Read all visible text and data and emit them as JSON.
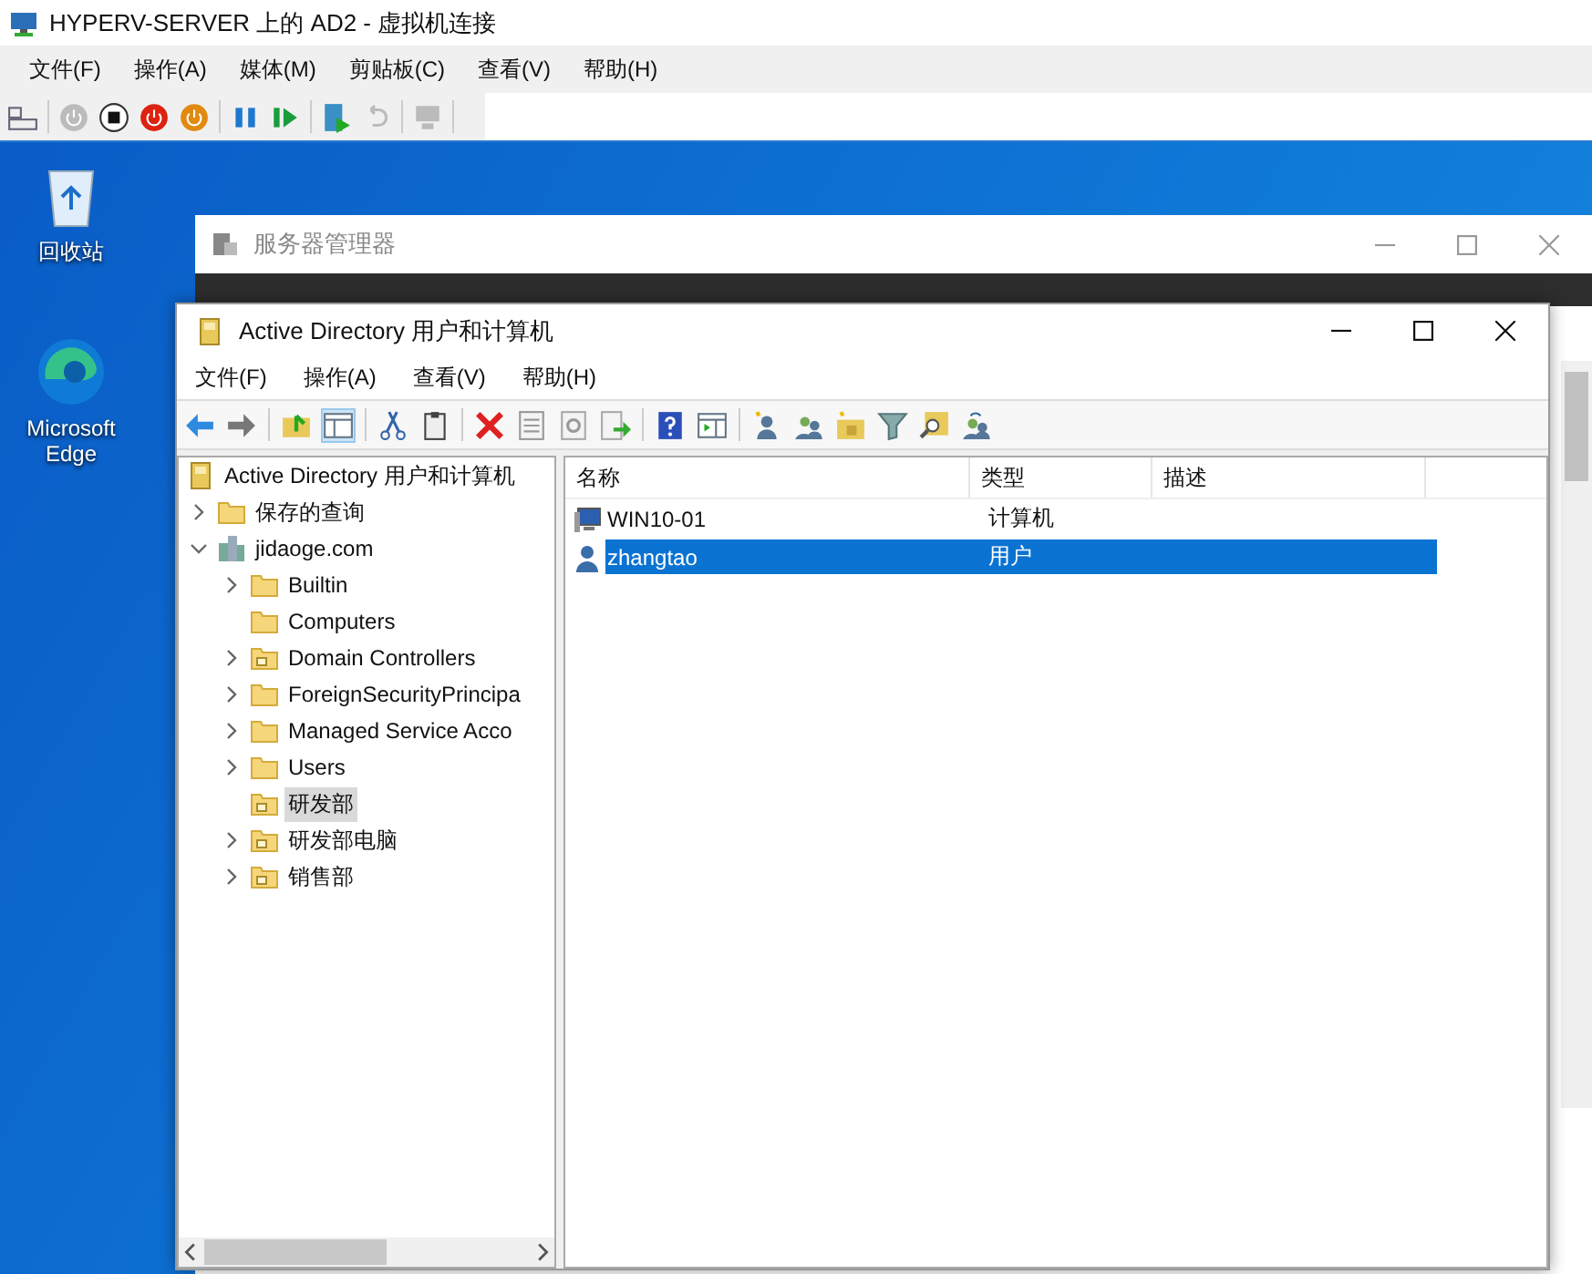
{
  "vm_window": {
    "title": "HYPERV-SERVER 上的 AD2 - 虚拟机连接",
    "menu": [
      "文件(F)",
      "操作(A)",
      "媒体(M)",
      "剪贴板(C)",
      "查看(V)",
      "帮助(H)"
    ]
  },
  "desktop_icons": [
    {
      "label": "回收站",
      "kind": "recycle"
    },
    {
      "label": "Microsoft Edge",
      "kind": "edge"
    }
  ],
  "background_window": {
    "title": "服务器管理器"
  },
  "aduc_window": {
    "title": "Active Directory 用户和计算机",
    "menu": [
      "文件(F)",
      "操作(A)",
      "查看(V)",
      "帮助(H)"
    ],
    "tree": {
      "label": "Active Directory 用户和计算机",
      "kind": "root",
      "selected": false,
      "children": [
        {
          "label": "保存的查询",
          "kind": "folder",
          "selected": false,
          "expandable": true,
          "expanded": false
        },
        {
          "label": "jidaoge.com",
          "kind": "domain",
          "selected": false,
          "expandable": true,
          "expanded": true,
          "children": [
            {
              "label": "Builtin",
              "kind": "folder",
              "selected": false,
              "expandable": true,
              "expanded": false
            },
            {
              "label": "Computers",
              "kind": "folder",
              "selected": false,
              "expandable": false
            },
            {
              "label": "Domain Controllers",
              "kind": "ou",
              "selected": false,
              "expandable": true,
              "expanded": false
            },
            {
              "label": "ForeignSecurityPrincipa",
              "kind": "folder",
              "selected": false,
              "expandable": true,
              "expanded": false
            },
            {
              "label": "Managed Service Acco",
              "kind": "folder",
              "selected": false,
              "expandable": true,
              "expanded": false
            },
            {
              "label": "Users",
              "kind": "folder",
              "selected": false,
              "expandable": true,
              "expanded": false
            },
            {
              "label": "研发部",
              "kind": "ou",
              "selected": true,
              "expandable": false
            },
            {
              "label": "研发部电脑",
              "kind": "ou",
              "selected": false,
              "expandable": true,
              "expanded": false
            },
            {
              "label": "销售部",
              "kind": "ou",
              "selected": false,
              "expandable": true,
              "expanded": false
            }
          ]
        }
      ]
    },
    "columns": [
      "名称",
      "类型",
      "描述"
    ],
    "rows": [
      {
        "name": "WIN10-01",
        "type": "计算机",
        "kind": "computer",
        "selected": false
      },
      {
        "name": "zhangtao",
        "type": "用户",
        "kind": "user",
        "selected": true
      }
    ]
  }
}
